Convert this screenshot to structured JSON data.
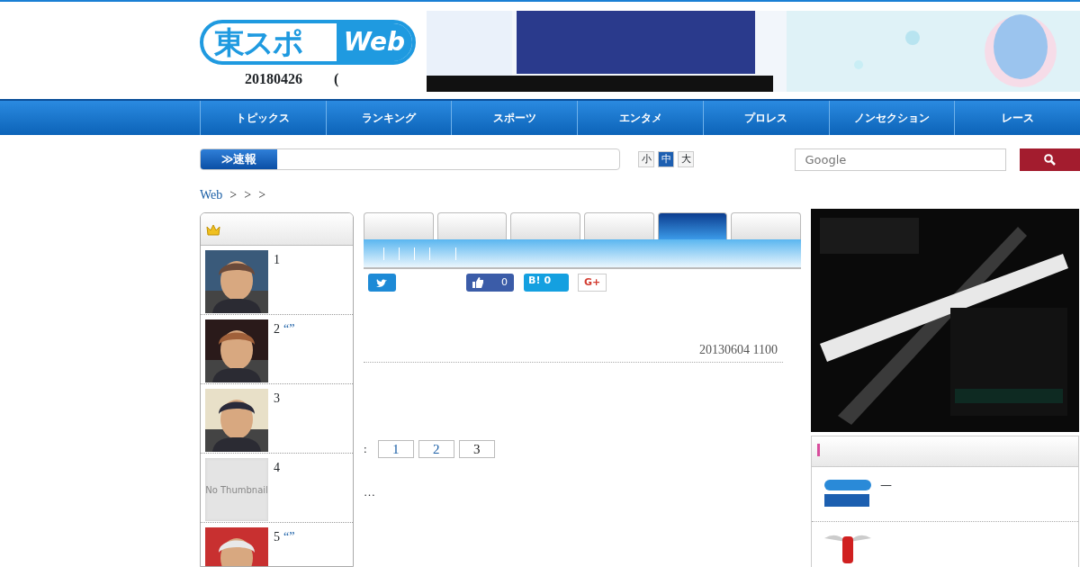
{
  "header": {
    "logo_main": "東スポ",
    "logo_sub": "Web",
    "date": "20180426",
    "date_suffix": "("
  },
  "nav": [
    "トピックス",
    "ランキング",
    "スポーツ",
    "エンタメ",
    "プロレス",
    "ノンセクション",
    "レース"
  ],
  "ticker": {
    "label": "≫速報"
  },
  "font_sizes": [
    {
      "label": "小",
      "selected": false
    },
    {
      "label": "中",
      "selected": true
    },
    {
      "label": "大",
      "selected": false
    }
  ],
  "search": {
    "placeholder": "Google"
  },
  "breadcrumb": [
    "Web",
    ">",
    ">",
    ">"
  ],
  "ranking": [
    {
      "rank": "1",
      "kind": "picture"
    },
    {
      "rank": "2",
      "quote": "“”",
      "kind": "picture"
    },
    {
      "rank": "3",
      "kind": "picture"
    },
    {
      "rank": "4",
      "kind": "no_thumbnail",
      "placeholder_text": "No Thumbnail"
    },
    {
      "rank": "5",
      "quote": "“”",
      "kind": "picture"
    }
  ],
  "tabs": [
    {
      "selected": false
    },
    {
      "selected": false
    },
    {
      "selected": false
    },
    {
      "selected": false
    },
    {
      "selected": true
    },
    {
      "selected": false
    }
  ],
  "share": {
    "like_count": "0",
    "hatena_label": "B!",
    "hatena_count": "0",
    "gplus_label": "G+"
  },
  "article": {
    "date": "20130604 1100",
    "pagination_label": ":",
    "pages": [
      {
        "label": "1",
        "selected": false
      },
      {
        "label": "2",
        "selected": false
      },
      {
        "label": "3",
        "selected": true
      }
    ],
    "ellipsis": "…"
  },
  "side_panel": {
    "items": [
      {
        "kind": "select_logo",
        "text": "—"
      },
      {
        "kind": "wings_logo"
      }
    ]
  }
}
